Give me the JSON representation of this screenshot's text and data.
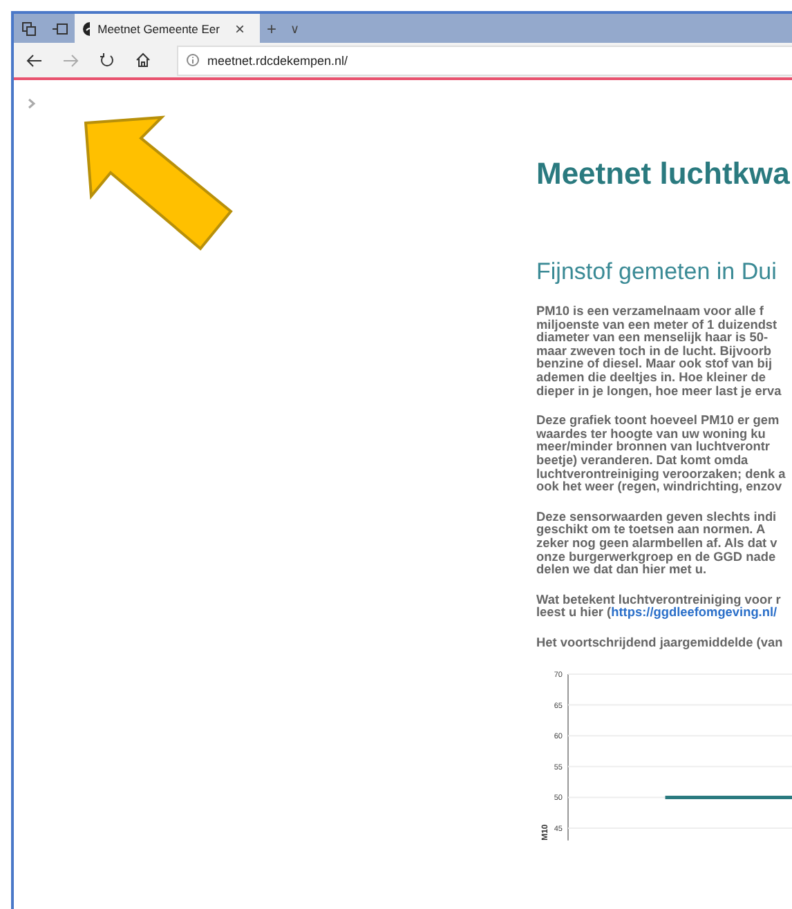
{
  "browser": {
    "tab_title": "Meetnet Gemeente Eer",
    "tab_close": "×",
    "new_tab": "+",
    "tab_menu": "∨",
    "address": "meetnet.rdcdekempen.nl/"
  },
  "page": {
    "heading": "Meetnet luchtkwa",
    "subheading": "Fijnstof gemeten in Dui",
    "paragraphs": [
      {
        "lines": [
          "PM10 is een verzamelnaam voor alle f",
          "miljoenste van een meter of 1 duizendst",
          "diameter van een menselijk haar is 50-",
          "maar zweven toch in de lucht. Bijvoorb",
          "benzine of diesel. Maar ook stof van bij",
          "ademen die deeltjes in. Hoe kleiner de",
          "dieper in je longen, hoe meer last je erva"
        ]
      },
      {
        "lines": [
          "Deze grafiek toont hoeveel PM10 er gem",
          "waardes ter hoogte van uw woning ku",
          "meer/minder bronnen van luchtverontr",
          "beetje) veranderen. Dat komt omda",
          "luchtverontreiniging veroorzaken; denk a",
          "ook het weer (regen, windrichting, enzov"
        ]
      },
      {
        "lines": [
          "Deze sensorwaarden geven slechts indi",
          "geschikt om te toetsen aan normen. A",
          "zeker nog geen alarmbellen af. Als dat v",
          "onze burgerwerkgroep en de GGD nade",
          "delen we dat dan hier met u."
        ]
      },
      {
        "lines": [
          "Wat betekent luchtverontreiniging voor r",
          "leest u hier ("
        ],
        "link": "https://ggdleefomgeving.nl/"
      },
      {
        "lines": [
          "Het voortschrijdend jaargemiddelde (van"
        ]
      }
    ],
    "chart_data": {
      "type": "line",
      "ylabel": "M10",
      "ylim": [
        43,
        70
      ],
      "yticks": [
        45,
        50,
        55,
        60,
        65,
        70
      ],
      "grid": true,
      "series": [
        {
          "color": "#2a7a7f",
          "values": [
            null,
            null,
            null,
            50,
            50,
            50,
            50,
            50
          ]
        }
      ]
    }
  }
}
